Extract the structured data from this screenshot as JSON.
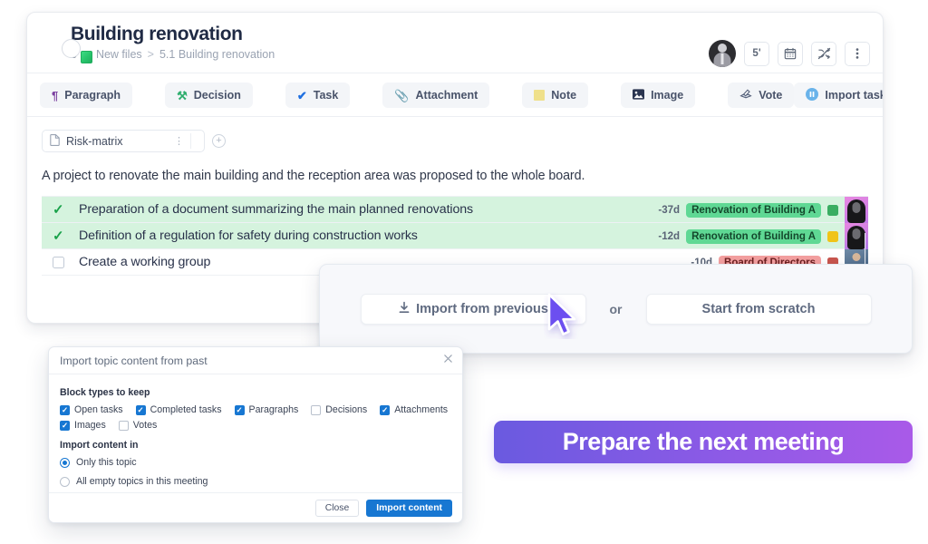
{
  "topic": {
    "title": "Building renovation",
    "breadcrumb_number": "5",
    "breadcrumb_parent": "New files",
    "breadcrumb_sep": ">",
    "breadcrumb_current": "5.1 Building renovation"
  },
  "header_tools": {
    "timer_label": "5'",
    "calendar_icon": "calendar-icon",
    "shuffle_off_icon": "shuffle-off-icon",
    "more_icon": "kebab-menu-icon",
    "avatar": "user-avatar"
  },
  "block_bar": [
    {
      "label": "Paragraph",
      "icon": "paragraph-pilcrow-icon",
      "glyph": "¶",
      "color": "#7b3fa0"
    },
    {
      "label": "Decision",
      "icon": "decision-gavel-icon",
      "glyph": "🔨",
      "color": "#2fae6e"
    },
    {
      "label": "Task",
      "icon": "task-check-icon",
      "glyph": "✔",
      "color": "#1f6fe0"
    },
    {
      "label": "Attachment",
      "icon": "attachment-paperclip-icon",
      "glyph": "📎",
      "color": "#e08a8a"
    },
    {
      "label": "Note",
      "icon": "note-sticky-icon",
      "glyph": "🗒",
      "color": "#e8d26a"
    },
    {
      "label": "Image",
      "icon": "image-picture-icon",
      "glyph": "🖼",
      "color": "#2a3550"
    },
    {
      "label": "Vote",
      "icon": "vote-ballot-icon",
      "glyph": "🗳",
      "color": "#54607a"
    },
    {
      "label": "Import tasks",
      "icon": "import-tasks-icon",
      "glyph": "⏸",
      "color": "#5aa9e8"
    }
  ],
  "content": {
    "doc_chip_label": "Risk-matrix",
    "doc_chip_icon": "file-document-icon",
    "doc_chip_kebab": "⋮",
    "add_block_icon": "plus-circle-icon",
    "paragraph": "A project to renovate the main building and the reception area was proposed to the whole board."
  },
  "tasks": [
    {
      "text": "Preparation of a document summarizing the main planned renovations",
      "done": true,
      "due": "-37d",
      "tag": "Renovation of Building A",
      "tag_color": "green",
      "status_color": "green",
      "avatar": "assignee-avatar-1"
    },
    {
      "text": "Definition of a regulation for safety during construction works",
      "done": true,
      "due": "-12d",
      "tag": "Renovation of Building A",
      "tag_color": "green",
      "status_color": "yellow",
      "avatar": "assignee-avatar-2"
    },
    {
      "text": "Create a working group",
      "done": false,
      "due": "-10d",
      "tag": "Board of Directors",
      "tag_color": "red",
      "status_color": "red",
      "avatar": "assignee-avatar-3"
    }
  ],
  "choice_panel": {
    "import_label": "Import from previous",
    "import_icon": "download-import-icon",
    "or_label": "or",
    "scratch_label": "Start from scratch"
  },
  "modal": {
    "title": "Import topic content from past",
    "close_icon": "close-x-icon",
    "section_blocks_label": "Block types to keep",
    "checkboxes": [
      {
        "label": "Open tasks",
        "checked": true
      },
      {
        "label": "Completed tasks",
        "checked": true
      },
      {
        "label": "Paragraphs",
        "checked": true
      },
      {
        "label": "Decisions",
        "checked": false
      },
      {
        "label": "Attachments",
        "checked": true
      },
      {
        "label": "Images",
        "checked": true
      },
      {
        "label": "Votes",
        "checked": false
      }
    ],
    "section_scope_label": "Import content in",
    "radios": [
      {
        "label": "Only this topic",
        "selected": true
      },
      {
        "label": "All empty topics in this meeting",
        "selected": false
      }
    ],
    "close_button": "Close",
    "primary_button": "Import content"
  },
  "cta": {
    "label": "Prepare the next meeting"
  },
  "colors": {
    "primary_blue": "#1777d2",
    "cta_gradient_start": "#6a5ae0",
    "cta_gradient_end": "#a95ae8",
    "task_done_bg": "#d5f3de",
    "tag_green": "#5fd894",
    "tag_red": "#f4a0a0",
    "cursor_purple": "#6c4ff0"
  }
}
